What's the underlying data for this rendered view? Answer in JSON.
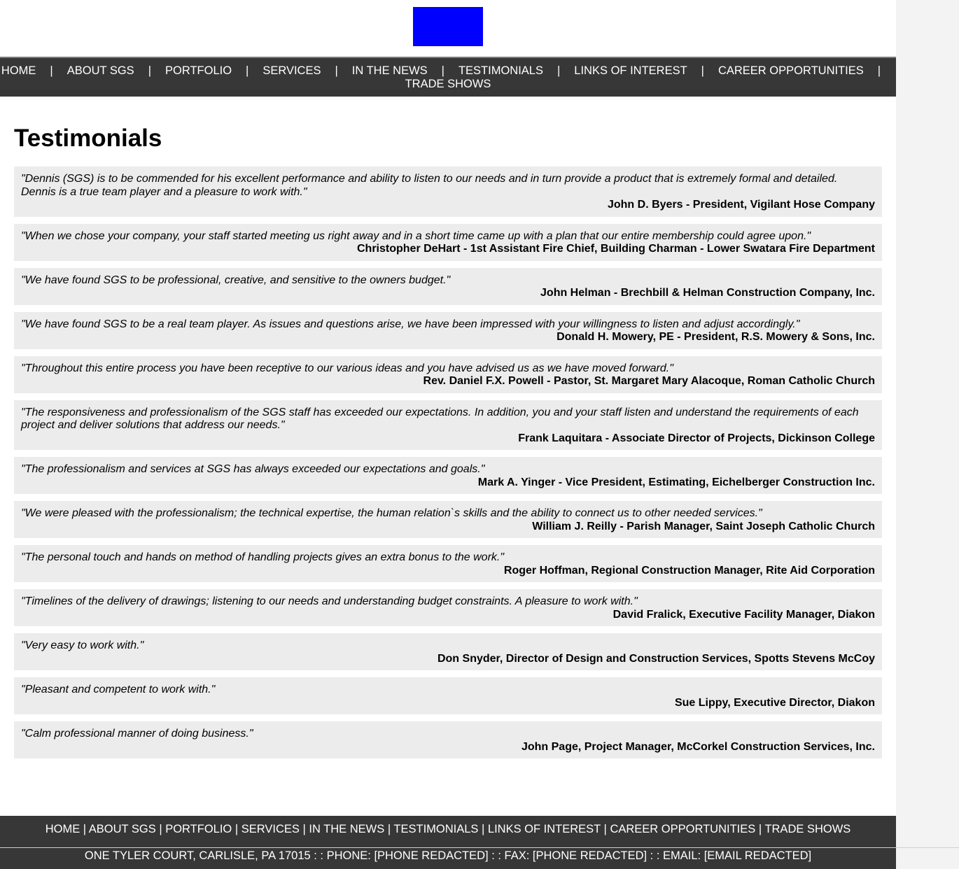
{
  "logo": {
    "color": "#0000ff"
  },
  "nav": {
    "items": [
      "HOME",
      "ABOUT SGS",
      "PORTFOLIO",
      "SERVICES",
      "IN THE NEWS",
      "TESTIMONIALS",
      "LINKS OF INTEREST",
      "CAREER OPPORTUNITIES",
      "TRADE SHOWS"
    ],
    "separator": "|"
  },
  "page": {
    "title": "Testimonials"
  },
  "testimonials": [
    {
      "quote": "\"Dennis (SGS) is to be commended for his excellent performance and ability to listen to our needs and in turn provide a product that is extremely formal and detailed. Dennis is a true team player and a pleasure to work with.\"",
      "author": "John D. Byers - President, Vigilant Hose Company"
    },
    {
      "quote": "\"When we chose your company, your staff started meeting us right away and in a short time came up with a plan that our entire membership could agree upon.\"",
      "author": "Christopher DeHart - 1st Assistant Fire Chief, Building Charman - Lower Swatara Fire Department"
    },
    {
      "quote": "\"We have found SGS to be professional, creative, and sensitive to the owners budget.\"",
      "author": "John Helman - Brechbill & Helman Construction Company, Inc."
    },
    {
      "quote": "\"We have found SGS to be a real team player. As issues and questions arise, we have been impressed with your willingness to listen and adjust accordingly.\"",
      "author": "Donald H. Mowery, PE - President, R.S. Mowery & Sons, Inc."
    },
    {
      "quote": "\"Throughout this entire process you have been receptive to our various ideas and you have advised us as we have moved forward.\"",
      "author": "Rev. Daniel F.X. Powell - Pastor, St. Margaret Mary Alacoque, Roman Catholic Church"
    },
    {
      "quote": "\"The responsiveness and professionalism of the SGS staff has exceeded our expectations. In addition, you and your staff listen and understand the requirements of each project and deliver solutions that address our needs.\"",
      "author": "Frank Laquitara - Associate Director of Projects, Dickinson College"
    },
    {
      "quote": "\"The professionalism and services at SGS has always exceeded our expectations and goals.\"",
      "author": "Mark A. Yinger - Vice President, Estimating, Eichelberger Construction Inc."
    },
    {
      "quote": "\"We were pleased with the professionalism; the technical expertise, the human relation`s skills and the ability to connect us to other needed services.\"",
      "author": "William J. Reilly - Parish Manager, Saint Joseph Catholic Church"
    },
    {
      "quote": "\"The personal touch and hands on method of handling projects gives an extra bonus to the work.\"",
      "author": "Roger Hoffman, Regional Construction Manager, Rite Aid Corporation"
    },
    {
      "quote": "\"Timelines of the delivery of drawings; listening to our needs and understanding budget constraints. A pleasure to work with.\"",
      "author": "David Fralick, Executive Facility Manager, Diakon"
    },
    {
      "quote": "\"Very easy to work with.\"",
      "author": "Don Snyder, Director of Design and Construction Services, Spotts Stevens McCoy"
    },
    {
      "quote": "\"Pleasant and competent to work with.\"",
      "author": "Sue Lippy, Executive Director, Diakon"
    },
    {
      "quote": "\"Calm professional manner of doing business.\"",
      "author": "John Page, Project Manager, McCorkel Construction Services, Inc."
    }
  ],
  "footer": {
    "address": "ONE TYLER COURT, CARLISLE, PA 17015 : : PHONE: [PHONE REDACTED] : : FAX: [PHONE REDACTED] : : EMAIL: [EMAIL REDACTED]"
  }
}
